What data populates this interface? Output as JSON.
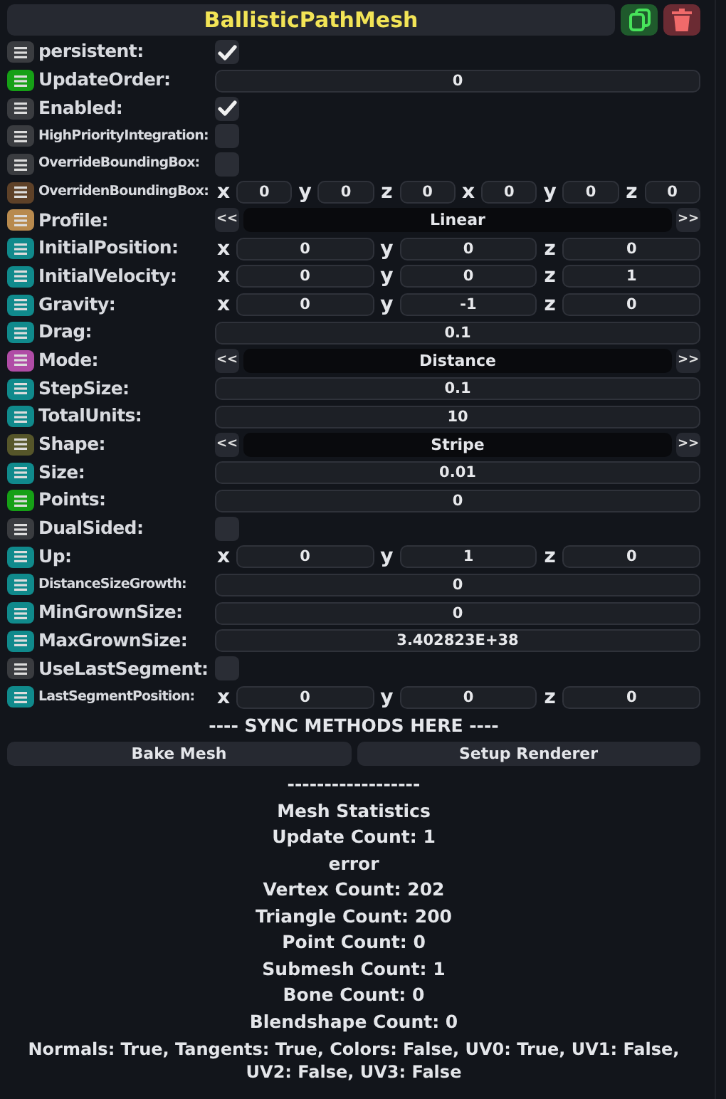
{
  "header": {
    "title": "BallisticPathMesh"
  },
  "fields": [
    {
      "label": "persistent:",
      "color": "#3a3c40",
      "small_label": false,
      "kind": "bool",
      "checked": true
    },
    {
      "label": "UpdateOrder:",
      "color": "#16a016",
      "small_label": false,
      "kind": "value",
      "value": "0"
    },
    {
      "label": "Enabled:",
      "color": "#3a3c40",
      "small_label": false,
      "kind": "bool",
      "checked": true
    },
    {
      "label": "HighPriorityIntegration:",
      "color": "#3a3c40",
      "small_label": true,
      "kind": "bool",
      "checked": false
    },
    {
      "label": "OverrideBoundingBox:",
      "color": "#3a3c40",
      "small_label": true,
      "kind": "bool",
      "checked": false
    },
    {
      "label": "OverridenBoundingBox:",
      "color": "#5e4128",
      "small_label": true,
      "kind": "vector",
      "components": [
        {
          "axis": "x",
          "value": "0"
        },
        {
          "axis": "y",
          "value": "0"
        },
        {
          "axis": "z",
          "value": "0"
        },
        {
          "axis": "x",
          "value": "0"
        },
        {
          "axis": "y",
          "value": "0"
        },
        {
          "axis": "z",
          "value": "0"
        }
      ]
    },
    {
      "label": "Profile:",
      "color": "#b88a4e",
      "small_label": false,
      "kind": "enum",
      "prev": "<<",
      "value": "Linear",
      "next": ">>"
    },
    {
      "label": "InitialPosition:",
      "color": "#108a8c",
      "small_label": false,
      "kind": "vector",
      "components": [
        {
          "axis": "x",
          "value": "0"
        },
        {
          "axis": "y",
          "value": "0"
        },
        {
          "axis": "z",
          "value": "0"
        }
      ]
    },
    {
      "label": "InitialVelocity:",
      "color": "#108a8c",
      "small_label": false,
      "kind": "vector",
      "components": [
        {
          "axis": "x",
          "value": "0"
        },
        {
          "axis": "y",
          "value": "0"
        },
        {
          "axis": "z",
          "value": "1"
        }
      ]
    },
    {
      "label": "Gravity:",
      "color": "#108a8c",
      "small_label": false,
      "kind": "vector",
      "components": [
        {
          "axis": "x",
          "value": "0"
        },
        {
          "axis": "y",
          "value": "-1"
        },
        {
          "axis": "z",
          "value": "0"
        }
      ]
    },
    {
      "label": "Drag:",
      "color": "#108a8c",
      "small_label": false,
      "kind": "value",
      "value": "0.1"
    },
    {
      "label": "Mode:",
      "color": "#b04ca6",
      "small_label": false,
      "kind": "enum",
      "prev": "<<",
      "value": "Distance",
      "next": ">>"
    },
    {
      "label": "StepSize:",
      "color": "#108a8c",
      "small_label": false,
      "kind": "value",
      "value": "0.1"
    },
    {
      "label": "TotalUnits:",
      "color": "#108a8c",
      "small_label": false,
      "kind": "value",
      "value": "10"
    },
    {
      "label": "Shape:",
      "color": "#56562a",
      "small_label": false,
      "kind": "enum",
      "prev": "<<",
      "value": "Stripe",
      "next": ">>"
    },
    {
      "label": "Size:",
      "color": "#108a8c",
      "small_label": false,
      "kind": "value",
      "value": "0.01"
    },
    {
      "label": "Points:",
      "color": "#16a016",
      "small_label": false,
      "kind": "value",
      "value": "0"
    },
    {
      "label": "DualSided:",
      "color": "#3a3c40",
      "small_label": false,
      "kind": "bool",
      "checked": false
    },
    {
      "label": "Up:",
      "color": "#108a8c",
      "small_label": false,
      "kind": "vector",
      "components": [
        {
          "axis": "x",
          "value": "0"
        },
        {
          "axis": "y",
          "value": "1"
        },
        {
          "axis": "z",
          "value": "0"
        }
      ]
    },
    {
      "label": "DistanceSizeGrowth:",
      "color": "#108a8c",
      "small_label": true,
      "kind": "value",
      "value": "0"
    },
    {
      "label": "MinGrownSize:",
      "color": "#108a8c",
      "small_label": false,
      "kind": "value",
      "value": "0"
    },
    {
      "label": "MaxGrownSize:",
      "color": "#108a8c",
      "small_label": false,
      "kind": "value",
      "value": "3.402823E+38"
    },
    {
      "label": "UseLastSegment:",
      "color": "#3a3c40",
      "small_label": false,
      "kind": "bool",
      "checked": false
    },
    {
      "label": "LastSegmentPosition:",
      "color": "#108a8c",
      "small_label": true,
      "kind": "vector",
      "components": [
        {
          "axis": "x",
          "value": "0"
        },
        {
          "axis": "y",
          "value": "0"
        },
        {
          "axis": "z",
          "value": "0"
        }
      ]
    }
  ],
  "sync_heading": "---- SYNC METHODS HERE ----",
  "buttons": [
    "Bake Mesh",
    "Setup Renderer"
  ],
  "stats": [
    "------------------",
    "Mesh Statistics",
    "Update Count: 1",
    "error",
    "Vertex Count: 202",
    "Triangle Count: 200",
    "Point Count: 0",
    "Submesh Count: 1",
    "Bone Count: 0",
    "Blendshape Count: 0",
    "Normals: True, Tangents: True, Colors: False, UV0: True, UV1: False, UV2: False, UV3: False"
  ]
}
